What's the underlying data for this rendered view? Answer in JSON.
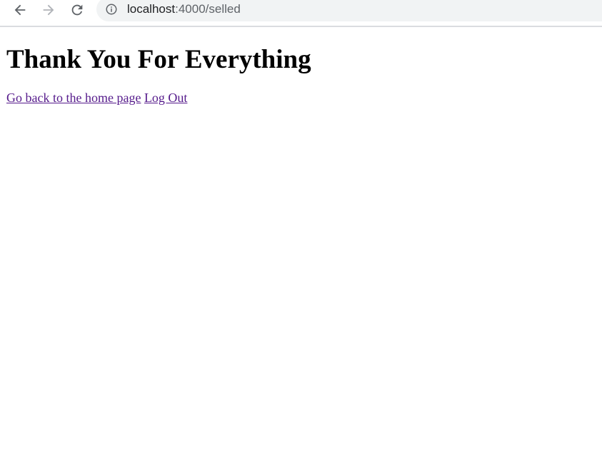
{
  "browser": {
    "url_host": "localhost",
    "url_path": ":4000/selled",
    "icons": {
      "back": "arrow-left-icon",
      "forward": "arrow-right-icon",
      "reload": "reload-icon",
      "info": "info-circle-icon"
    },
    "colors": {
      "omnibox_bg": "#f1f3f4",
      "icon_active": "#5f6368",
      "icon_disabled": "#b0b3b8"
    }
  },
  "page": {
    "title": "Thank You For Everything",
    "links": {
      "home": "Go back to the home page",
      "logout": "Log Out"
    },
    "colors": {
      "link_visited": "#551a8b",
      "text": "#000000"
    }
  }
}
